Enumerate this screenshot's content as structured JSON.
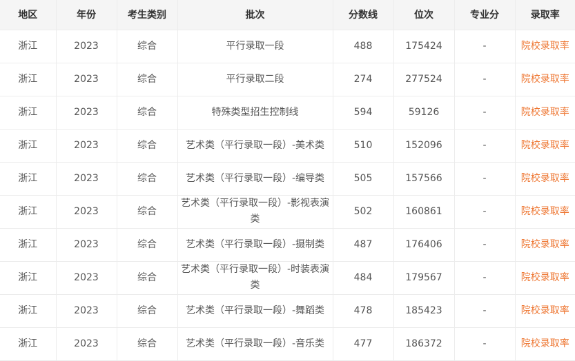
{
  "headers": [
    "地区",
    "年份",
    "考生类别",
    "批次",
    "分数线",
    "位次",
    "专业分",
    "录取率"
  ],
  "rows": [
    {
      "region": "浙江",
      "year": "2023",
      "type": "综合",
      "batch": "平行录取一段",
      "score": "488",
      "rank": "175424",
      "major": "-",
      "rate": "院校录取率"
    },
    {
      "region": "浙江",
      "year": "2023",
      "type": "综合",
      "batch": "平行录取二段",
      "score": "274",
      "rank": "277524",
      "major": "-",
      "rate": "院校录取率"
    },
    {
      "region": "浙江",
      "year": "2023",
      "type": "综合",
      "batch": "特殊类型招生控制线",
      "score": "594",
      "rank": "59126",
      "major": "-",
      "rate": "院校录取率"
    },
    {
      "region": "浙江",
      "year": "2023",
      "type": "综合",
      "batch": "艺术类（平行录取一段）-美术类",
      "score": "510",
      "rank": "152096",
      "major": "-",
      "rate": "院校录取率"
    },
    {
      "region": "浙江",
      "year": "2023",
      "type": "综合",
      "batch": "艺术类（平行录取一段）-编导类",
      "score": "505",
      "rank": "157566",
      "major": "-",
      "rate": "院校录取率"
    },
    {
      "region": "浙江",
      "year": "2023",
      "type": "综合",
      "batch": "艺术类（平行录取一段）-影视表演类",
      "score": "502",
      "rank": "160861",
      "major": "-",
      "rate": "院校录取率"
    },
    {
      "region": "浙江",
      "year": "2023",
      "type": "综合",
      "batch": "艺术类（平行录取一段）-摄制类",
      "score": "487",
      "rank": "176406",
      "major": "-",
      "rate": "院校录取率"
    },
    {
      "region": "浙江",
      "year": "2023",
      "type": "综合",
      "batch": "艺术类（平行录取一段）-时装表演类",
      "score": "484",
      "rank": "179567",
      "major": "-",
      "rate": "院校录取率"
    },
    {
      "region": "浙江",
      "year": "2023",
      "type": "综合",
      "batch": "艺术类（平行录取一段）-舞蹈类",
      "score": "478",
      "rank": "185423",
      "major": "-",
      "rate": "院校录取率"
    },
    {
      "region": "浙江",
      "year": "2023",
      "type": "综合",
      "batch": "艺术类（平行录取一段）-音乐类",
      "score": "477",
      "rank": "186372",
      "major": "-",
      "rate": "院校录取率"
    }
  ],
  "colors": {
    "link": "#ee7733",
    "header_bg": "#f5f5f5",
    "border": "#ececec"
  }
}
